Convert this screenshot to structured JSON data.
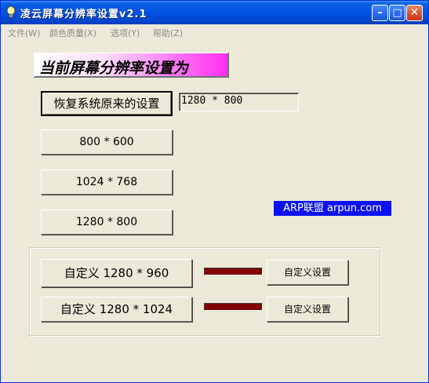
{
  "window": {
    "title": "凌云屏幕分辨率设置v2.1",
    "buttons": {
      "minimize": "–",
      "maximize": "□",
      "close": "✕"
    }
  },
  "menu": [
    {
      "label": "文件(W)"
    },
    {
      "label": "颜色质量(X)"
    },
    {
      "label": "选项(Y)"
    },
    {
      "label": "帮助(Z)"
    }
  ],
  "heading": "当前屏幕分辨率设置为",
  "restore_button": "恢复系统原来的设置",
  "current_resolution": "1280 * 800",
  "presets": [
    "800 * 600",
    "1024 * 768",
    "1280 * 800"
  ],
  "brand_label": "ARP联盟 arpun.com",
  "custom": [
    {
      "label": "自定义 1280 * 960",
      "settings_label": "自定义设置"
    },
    {
      "label": "自定义 1280 * 1024",
      "settings_label": "自定义设置"
    }
  ],
  "colors": {
    "title_bar": "#0054e3",
    "accent_bar": "#800000",
    "brand_bg": "#0b12f0",
    "heading_gradient_end": "#ff2ef0"
  }
}
